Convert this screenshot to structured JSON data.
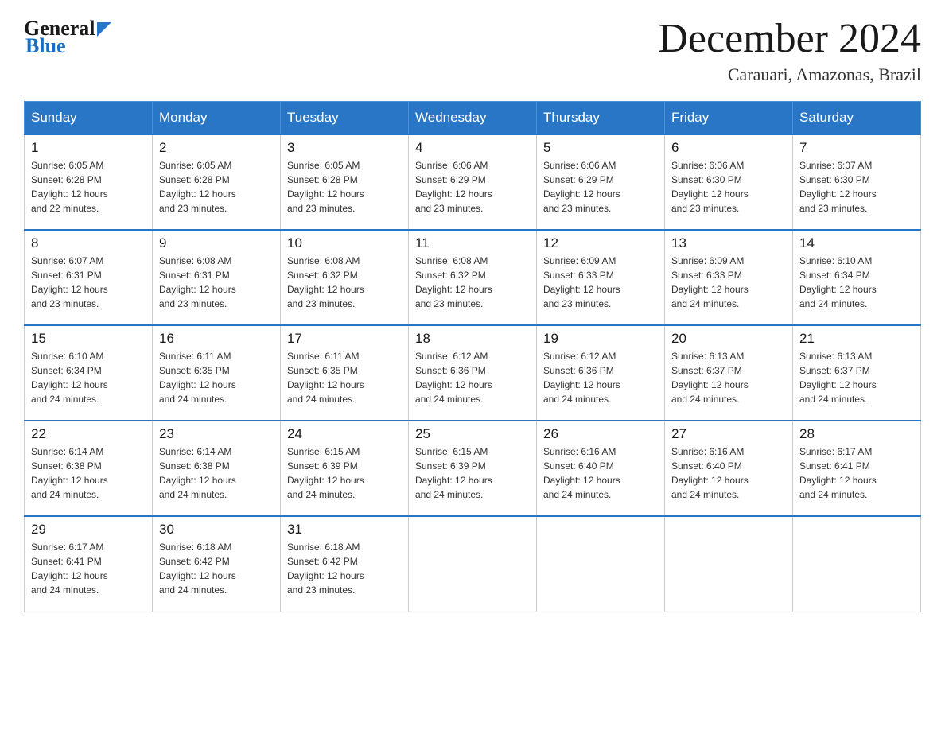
{
  "logo": {
    "general": "General",
    "blue": "Blue"
  },
  "title": "December 2024",
  "subtitle": "Carauari, Amazonas, Brazil",
  "days_of_week": [
    "Sunday",
    "Monday",
    "Tuesday",
    "Wednesday",
    "Thursday",
    "Friday",
    "Saturday"
  ],
  "weeks": [
    [
      {
        "day": "1",
        "sunrise": "6:05 AM",
        "sunset": "6:28 PM",
        "daylight": "12 hours and 22 minutes."
      },
      {
        "day": "2",
        "sunrise": "6:05 AM",
        "sunset": "6:28 PM",
        "daylight": "12 hours and 23 minutes."
      },
      {
        "day": "3",
        "sunrise": "6:05 AM",
        "sunset": "6:28 PM",
        "daylight": "12 hours and 23 minutes."
      },
      {
        "day": "4",
        "sunrise": "6:06 AM",
        "sunset": "6:29 PM",
        "daylight": "12 hours and 23 minutes."
      },
      {
        "day": "5",
        "sunrise": "6:06 AM",
        "sunset": "6:29 PM",
        "daylight": "12 hours and 23 minutes."
      },
      {
        "day": "6",
        "sunrise": "6:06 AM",
        "sunset": "6:30 PM",
        "daylight": "12 hours and 23 minutes."
      },
      {
        "day": "7",
        "sunrise": "6:07 AM",
        "sunset": "6:30 PM",
        "daylight": "12 hours and 23 minutes."
      }
    ],
    [
      {
        "day": "8",
        "sunrise": "6:07 AM",
        "sunset": "6:31 PM",
        "daylight": "12 hours and 23 minutes."
      },
      {
        "day": "9",
        "sunrise": "6:08 AM",
        "sunset": "6:31 PM",
        "daylight": "12 hours and 23 minutes."
      },
      {
        "day": "10",
        "sunrise": "6:08 AM",
        "sunset": "6:32 PM",
        "daylight": "12 hours and 23 minutes."
      },
      {
        "day": "11",
        "sunrise": "6:08 AM",
        "sunset": "6:32 PM",
        "daylight": "12 hours and 23 minutes."
      },
      {
        "day": "12",
        "sunrise": "6:09 AM",
        "sunset": "6:33 PM",
        "daylight": "12 hours and 23 minutes."
      },
      {
        "day": "13",
        "sunrise": "6:09 AM",
        "sunset": "6:33 PM",
        "daylight": "12 hours and 24 minutes."
      },
      {
        "day": "14",
        "sunrise": "6:10 AM",
        "sunset": "6:34 PM",
        "daylight": "12 hours and 24 minutes."
      }
    ],
    [
      {
        "day": "15",
        "sunrise": "6:10 AM",
        "sunset": "6:34 PM",
        "daylight": "12 hours and 24 minutes."
      },
      {
        "day": "16",
        "sunrise": "6:11 AM",
        "sunset": "6:35 PM",
        "daylight": "12 hours and 24 minutes."
      },
      {
        "day": "17",
        "sunrise": "6:11 AM",
        "sunset": "6:35 PM",
        "daylight": "12 hours and 24 minutes."
      },
      {
        "day": "18",
        "sunrise": "6:12 AM",
        "sunset": "6:36 PM",
        "daylight": "12 hours and 24 minutes."
      },
      {
        "day": "19",
        "sunrise": "6:12 AM",
        "sunset": "6:36 PM",
        "daylight": "12 hours and 24 minutes."
      },
      {
        "day": "20",
        "sunrise": "6:13 AM",
        "sunset": "6:37 PM",
        "daylight": "12 hours and 24 minutes."
      },
      {
        "day": "21",
        "sunrise": "6:13 AM",
        "sunset": "6:37 PM",
        "daylight": "12 hours and 24 minutes."
      }
    ],
    [
      {
        "day": "22",
        "sunrise": "6:14 AM",
        "sunset": "6:38 PM",
        "daylight": "12 hours and 24 minutes."
      },
      {
        "day": "23",
        "sunrise": "6:14 AM",
        "sunset": "6:38 PM",
        "daylight": "12 hours and 24 minutes."
      },
      {
        "day": "24",
        "sunrise": "6:15 AM",
        "sunset": "6:39 PM",
        "daylight": "12 hours and 24 minutes."
      },
      {
        "day": "25",
        "sunrise": "6:15 AM",
        "sunset": "6:39 PM",
        "daylight": "12 hours and 24 minutes."
      },
      {
        "day": "26",
        "sunrise": "6:16 AM",
        "sunset": "6:40 PM",
        "daylight": "12 hours and 24 minutes."
      },
      {
        "day": "27",
        "sunrise": "6:16 AM",
        "sunset": "6:40 PM",
        "daylight": "12 hours and 24 minutes."
      },
      {
        "day": "28",
        "sunrise": "6:17 AM",
        "sunset": "6:41 PM",
        "daylight": "12 hours and 24 minutes."
      }
    ],
    [
      {
        "day": "29",
        "sunrise": "6:17 AM",
        "sunset": "6:41 PM",
        "daylight": "12 hours and 24 minutes."
      },
      {
        "day": "30",
        "sunrise": "6:18 AM",
        "sunset": "6:42 PM",
        "daylight": "12 hours and 24 minutes."
      },
      {
        "day": "31",
        "sunrise": "6:18 AM",
        "sunset": "6:42 PM",
        "daylight": "12 hours and 23 minutes."
      },
      null,
      null,
      null,
      null
    ]
  ]
}
